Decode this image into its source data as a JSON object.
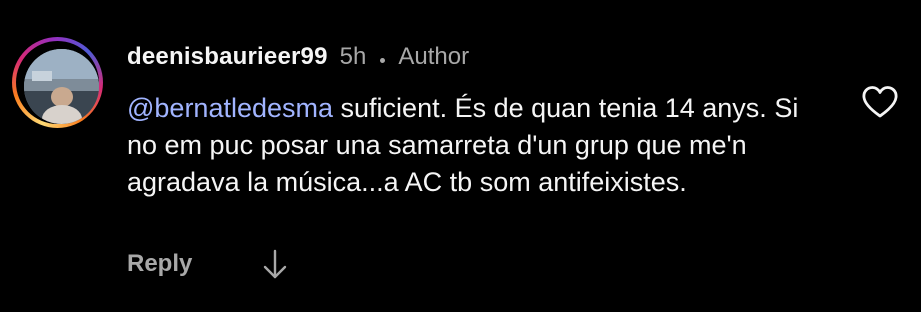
{
  "comment": {
    "username": "deenisbaurieer99",
    "time": "5h",
    "author_label": "Author",
    "mention": "@bernatledesma",
    "text": " suficient. És de quan tenia 14 anys. Si no em puc posar una samarreta d'un grup que me'n agradava la música...a AC tb som antifeixistes.",
    "reply_label": "Reply",
    "icons": {
      "like": "heart-icon",
      "more_replies": "arrow-down-icon"
    }
  },
  "colors": {
    "background": "#000000",
    "primary_text": "#f5f5f5",
    "secondary_text": "#a8a8a8",
    "mention": "#a1b4ff"
  }
}
